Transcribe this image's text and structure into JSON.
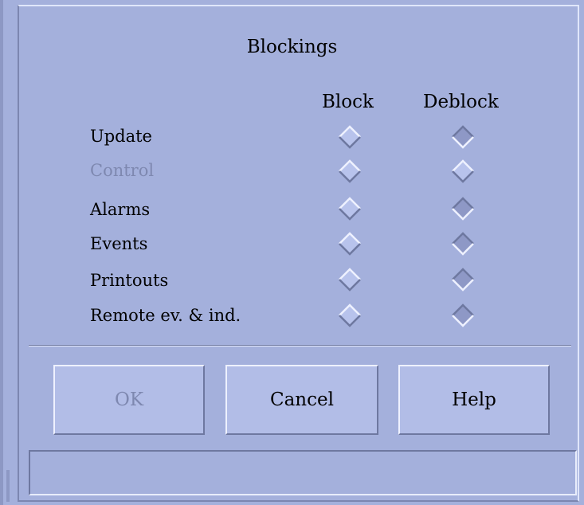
{
  "dialog": {
    "title": "Blockings",
    "columns": {
      "block": "Block",
      "deblock": "Deblock"
    },
    "rows": [
      {
        "label": "Update",
        "disabled": false,
        "block_state": "raised",
        "deblock_state": "sunken"
      },
      {
        "label": "Control",
        "disabled": true,
        "block_state": "raised",
        "deblock_state": "raised"
      },
      {
        "label": "Alarms",
        "disabled": false,
        "block_state": "raised",
        "deblock_state": "sunken"
      },
      {
        "label": "Events",
        "disabled": false,
        "block_state": "raised",
        "deblock_state": "sunken"
      },
      {
        "label": "Printouts",
        "disabled": false,
        "block_state": "raised",
        "deblock_state": "sunken"
      },
      {
        "label": "Remote ev. & ind.",
        "disabled": false,
        "block_state": "raised",
        "deblock_state": "sunken"
      }
    ],
    "buttons": {
      "ok": "OK",
      "cancel": "Cancel",
      "help": "Help"
    },
    "status_text": ""
  },
  "colors": {
    "background": "#a4b0dc",
    "button_face": "#b2bde7",
    "disabled_text": "#7e88b0",
    "shadow": "#6e78a0",
    "highlight": "#eef1ff"
  },
  "icons": {
    "radio": "diamond-radio-icon"
  }
}
